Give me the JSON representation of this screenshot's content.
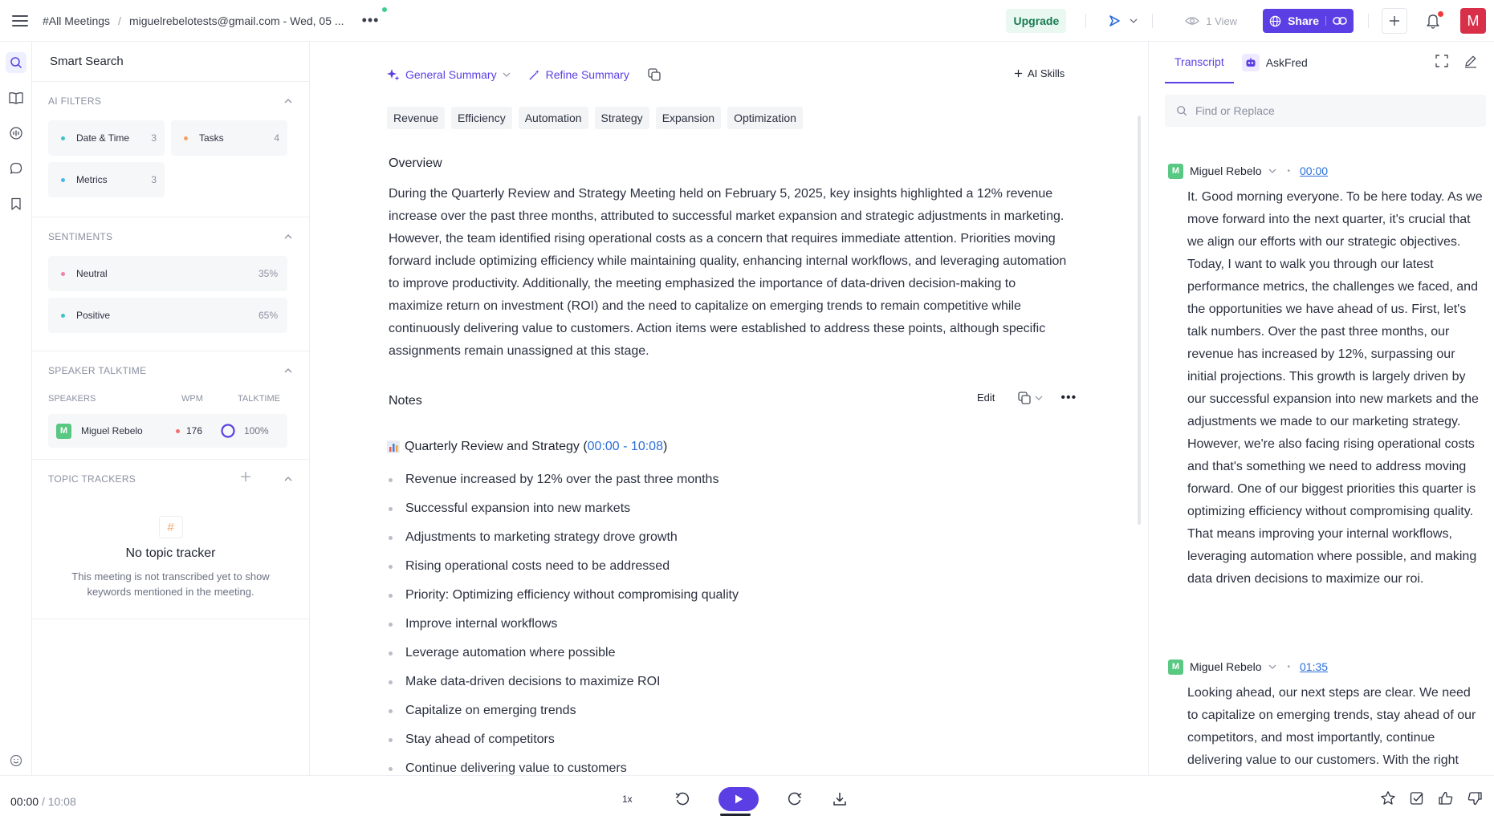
{
  "header": {
    "breadcrumb_root": "#All Meetings",
    "breadcrumb_sep": "/",
    "breadcrumb_meeting": "miguelrebelotests@gmail.com - Wed, 05 ...",
    "more": "•••",
    "upgrade": "Upgrade",
    "views": "1 View",
    "share": "Share",
    "avatar_letter": "M",
    "accent_color": "#5b3fe4"
  },
  "filters": {
    "smart_search": "Smart Search",
    "ai_filters": {
      "title": "AI FILTERS",
      "chips": [
        {
          "label": "Date & Time",
          "count": "3",
          "color": "#3fc3c9"
        },
        {
          "label": "Tasks",
          "count": "4",
          "color": "#f5a263"
        },
        {
          "label": "Metrics",
          "count": "3",
          "color": "#49b6e8"
        }
      ]
    },
    "sentiments": {
      "title": "SENTIMENTS",
      "items": [
        {
          "label": "Neutral",
          "pct": "35%",
          "color": "#f27fa7"
        },
        {
          "label": "Positive",
          "pct": "65%",
          "color": "#3fc3c9"
        }
      ]
    },
    "talktime": {
      "title": "SPEAKER TALKTIME",
      "col_speakers": "SPEAKERS",
      "col_wpm": "WPM",
      "col_talktime": "TALKTIME",
      "speaker": {
        "initial": "M",
        "name": "Miguel Rebelo",
        "wpm": "176",
        "talktime": "100%"
      }
    },
    "topics": {
      "title": "TOPIC TRACKERS",
      "empty_title": "No topic tracker",
      "empty_desc": "This meeting is not transcribed yet to show keywords mentioned in the meeting."
    }
  },
  "summary": {
    "general": "General Summary",
    "refine": "Refine Summary",
    "ai_skills": "AI Skills",
    "tags": [
      "Revenue",
      "Efficiency",
      "Automation",
      "Strategy",
      "Expansion",
      "Optimization"
    ],
    "overview_title": "Overview",
    "overview_text": "During the Quarterly Review and Strategy Meeting held on February 5, 2025, key insights highlighted a 12% revenue increase over the past three months, attributed to successful market expansion and strategic adjustments in marketing. However, the team identified rising operational costs as a concern that requires immediate attention. Priorities moving forward include optimizing efficiency while maintaining quality, enhancing internal workflows, and leveraging automation to improve productivity. Additionally, the meeting emphasized the importance of data-driven decision-making to maximize return on investment (ROI) and the need to capitalize on emerging trends to remain competitive while continuously delivering value to customers. Action items were established to address these points, although specific assignments remain unassigned at this stage.",
    "notes_title": "Notes",
    "edit": "Edit",
    "section_title": "Quarterly Review and Strategy (",
    "section_start": "00:00",
    "section_dash": " - ",
    "section_end": "10:08",
    "section_close": ")",
    "bullets": [
      "Revenue increased by 12% over the past three months",
      "Successful expansion into new markets",
      "Adjustments to marketing strategy drove growth",
      "Rising operational costs need to be addressed",
      "Priority: Optimizing efficiency without compromising quality",
      "Improve internal workflows",
      "Leverage automation where possible",
      "Make data-driven decisions to maximize ROI",
      "Capitalize on emerging trends",
      "Stay ahead of competitors",
      "Continue delivering value to customers"
    ]
  },
  "transcript": {
    "tab_transcript": "Transcript",
    "tab_askfred": "AskFred",
    "find_placeholder": "Find or Replace",
    "segments": [
      {
        "initial": "M",
        "speaker": "Miguel Rebelo",
        "time": "00:00",
        "text": "It. Good morning everyone. To be here today. As we move forward into the next quarter, it's crucial that we align our efforts with our strategic objectives. Today, I want to walk you through our latest performance metrics, the challenges we faced, and the opportunities we have ahead of us. First, let's talk numbers. Over the past three months, our revenue has increased by 12%, surpassing our initial projections. This growth is largely driven by our successful expansion into new markets and the adjustments we made to our marketing strategy. However, we're also facing rising operational costs and that's something we need to address moving forward. One of our biggest priorities this quarter is optimizing efficiency without compromising quality. That means improving your internal workflows, leveraging automation where possible, and making data driven decisions to maximize our roi."
      },
      {
        "initial": "M",
        "speaker": "Miguel Rebelo",
        "time": "01:35",
        "text": "Looking ahead, our next steps are clear. We need to capitalize on emerging trends, stay ahead of our competitors, and most importantly, continue delivering value to our customers. With the right strategy, collaboration and execution, I am"
      }
    ]
  },
  "player": {
    "current": "00:00",
    "total": "/ 10:08",
    "speed": "1x"
  }
}
